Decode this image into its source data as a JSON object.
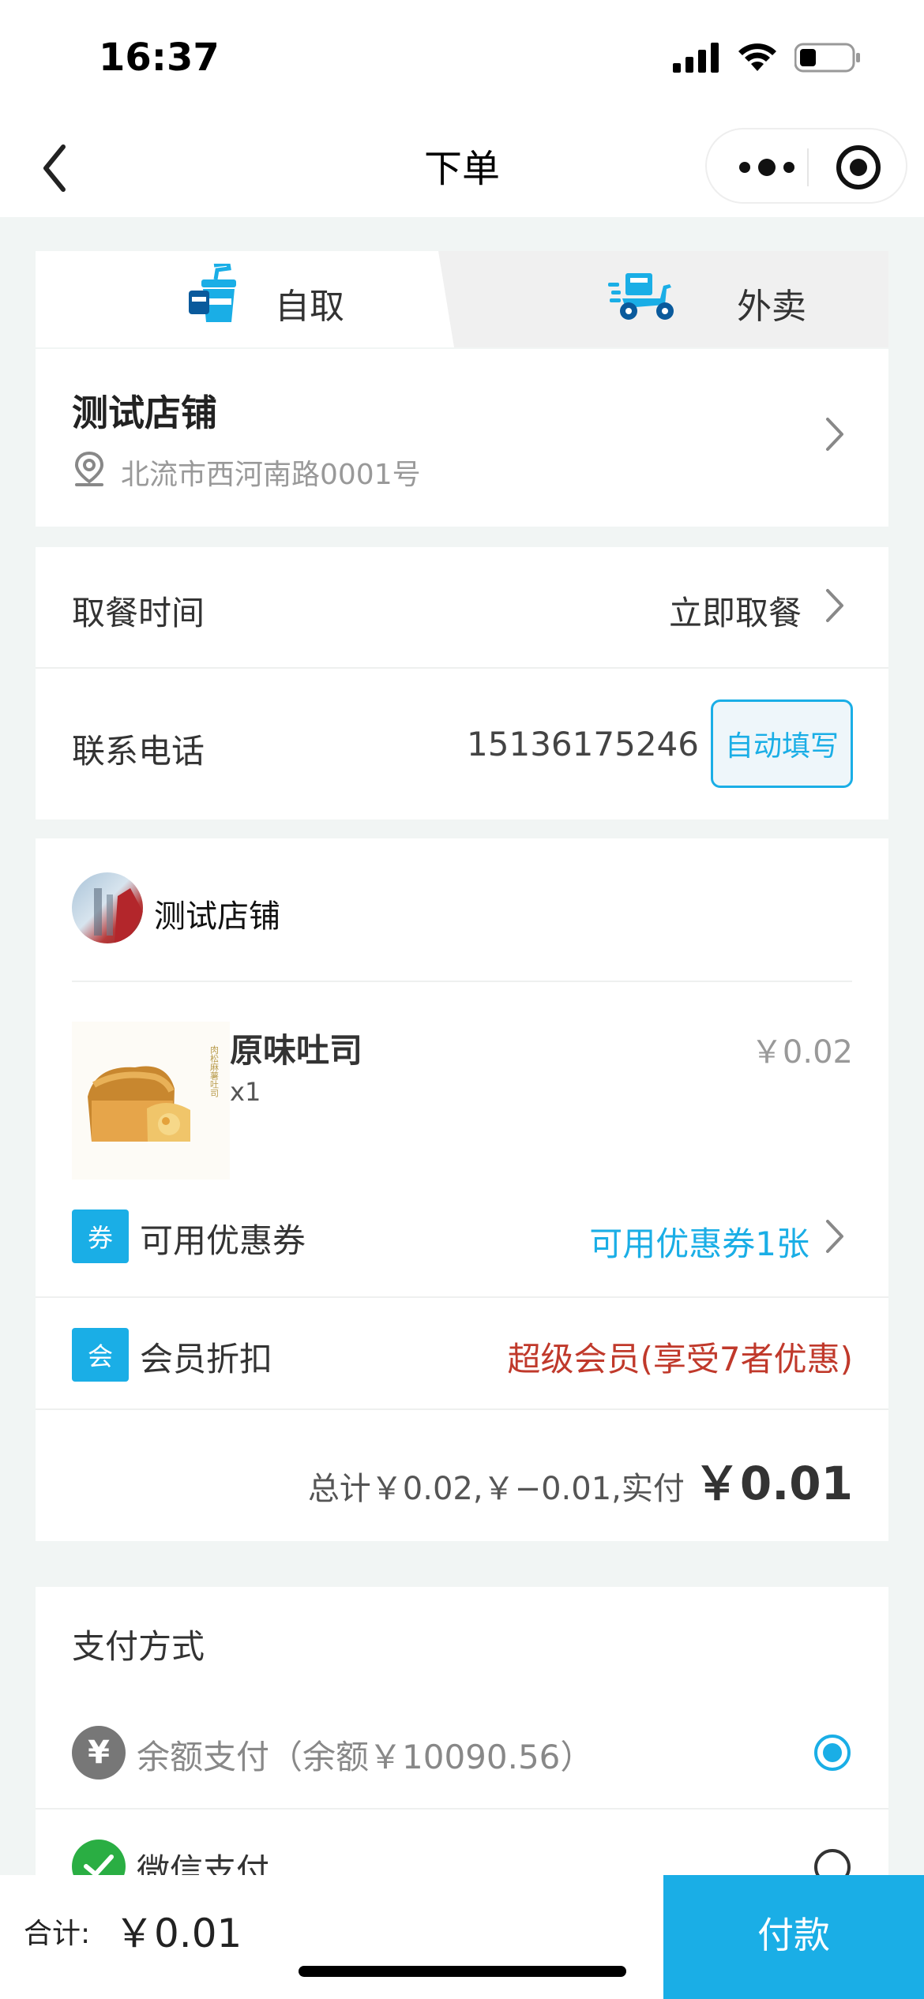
{
  "status_bar": {
    "time": "16:37"
  },
  "nav": {
    "title": "下单"
  },
  "tabs": {
    "pickup": "自取",
    "delivery": "外卖"
  },
  "shop": {
    "name": "测试店铺",
    "address": "北流市西河南路0001号"
  },
  "pickup_time": {
    "label": "取餐时间",
    "value": "立即取餐"
  },
  "contact": {
    "label": "联系电话",
    "phone": "15136175246",
    "autofill": "自动填写"
  },
  "order": {
    "store_name": "测试店铺",
    "items": [
      {
        "name": "原味吐司",
        "qty": "x1",
        "price": "￥0.02"
      }
    ],
    "coupon": {
      "tag": "券",
      "label": "可用优惠券",
      "value": "可用优惠券1张"
    },
    "member": {
      "tag": "会",
      "label": "会员折扣",
      "value": "超级会员(享受7者优惠)"
    },
    "total": {
      "text": "总计￥0.02,￥−0.01,实付",
      "amount": "￥0.01"
    }
  },
  "payment": {
    "title": "支付方式",
    "methods": [
      {
        "icon": "yen-icon",
        "label": "余额支付（余额￥10090.56）",
        "selected": true
      },
      {
        "icon": "wechat-pay-icon",
        "label": "微信支付",
        "selected": false
      }
    ]
  },
  "bottom": {
    "sum_label": "合计:",
    "sum_amount": "￥0.01",
    "pay_button": "付款"
  },
  "colors": {
    "accent": "#1aaee6",
    "member_red": "#c0392b"
  }
}
